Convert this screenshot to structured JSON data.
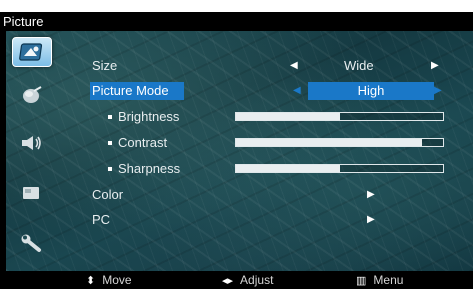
{
  "title": "Picture",
  "sidebar": {
    "icons": [
      {
        "name": "picture-icon",
        "selected": true
      },
      {
        "name": "sound-icon",
        "selected": false
      },
      {
        "name": "speaker-icon",
        "selected": false
      },
      {
        "name": "channel-icon",
        "selected": false
      },
      {
        "name": "setup-wrench-icon",
        "selected": false
      }
    ]
  },
  "menu": {
    "size": {
      "label": "Size",
      "value": "Wide"
    },
    "picture_mode": {
      "label": "Picture Mode",
      "value": "High"
    },
    "brightness": {
      "label": "Brightness",
      "level": 0.5
    },
    "contrast": {
      "label": "Contrast",
      "level": 0.9
    },
    "sharpness": {
      "label": "Sharpness",
      "level": 0.5
    },
    "color": {
      "label": "Color"
    },
    "pc": {
      "label": "PC"
    }
  },
  "footer": {
    "move": "Move",
    "adjust": "Adjust",
    "menu": "Menu"
  },
  "colors": {
    "highlight": "#1a78c8",
    "background": "#1d4a52"
  }
}
